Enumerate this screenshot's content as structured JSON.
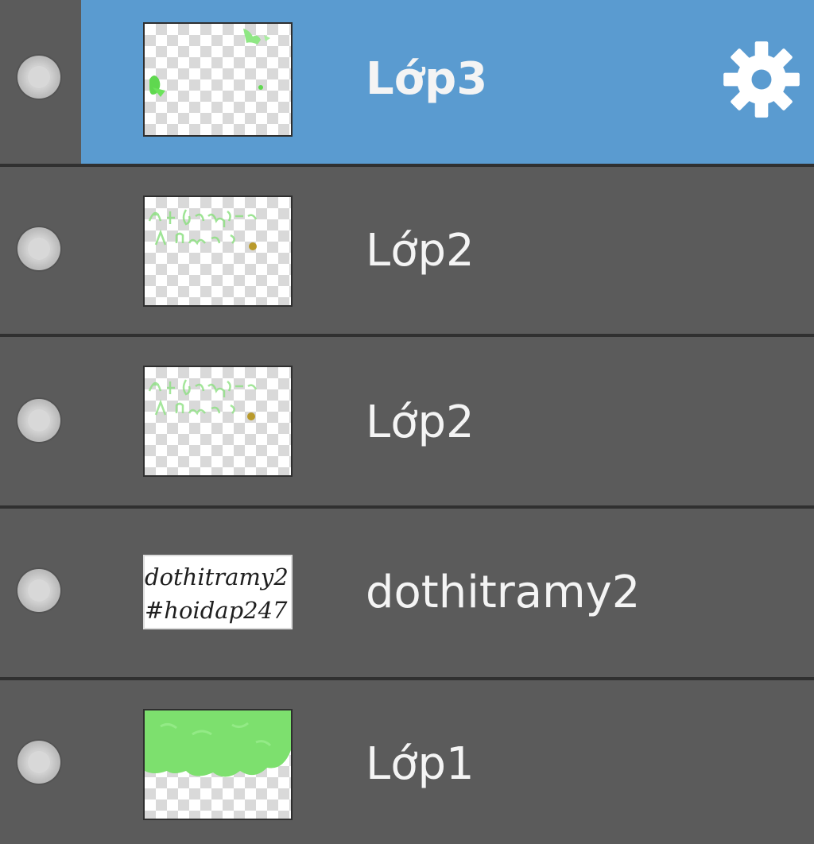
{
  "layers": [
    {
      "name": "Lớp3",
      "selected": true,
      "has_settings": true,
      "thumb": "green-sparse-transparent"
    },
    {
      "name": "Lớp2",
      "selected": false,
      "has_settings": false,
      "thumb": "green-faint-text-transparent"
    },
    {
      "name": "Lớp2",
      "selected": false,
      "has_settings": false,
      "thumb": "green-faint-text-transparent"
    },
    {
      "name": "dothitramy2",
      "selected": false,
      "has_settings": false,
      "thumb": "text-on-white"
    },
    {
      "name": "Lớp1",
      "selected": false,
      "has_settings": false,
      "thumb": "green-fill-top"
    }
  ],
  "thumbnail_text": {
    "line1": "dothitramy2",
    "line2": "#hoidap247"
  },
  "colors": {
    "panel_bg": "#5b5b5b",
    "selected_bg": "#5a9bd0",
    "divider": "#303030",
    "text": "#f4f4f4",
    "brush_green": "#7de06e"
  },
  "icons": {
    "visibility": "visibility-dot-icon",
    "settings": "gear-icon"
  }
}
